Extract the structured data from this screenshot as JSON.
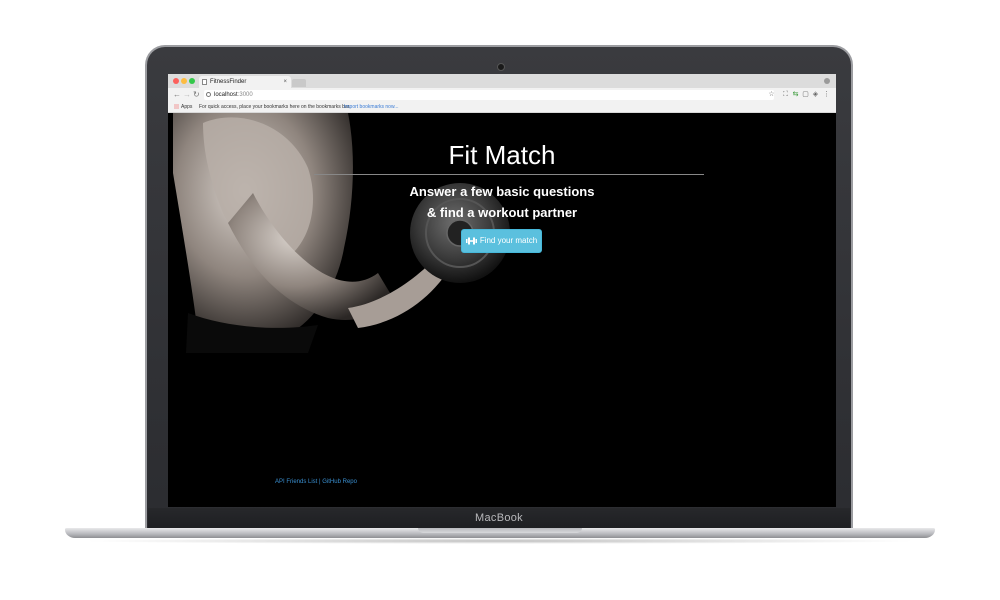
{
  "browser": {
    "tab_title": "FitnessFinder",
    "tab_close": "×",
    "url_host": "localhost",
    "url_port": ":3000",
    "bookmarks": {
      "apps_label": "Apps",
      "message": "For quick access, place your bookmarks here on the bookmarks bar.",
      "import_link": "Import bookmarks now..."
    }
  },
  "hero": {
    "title": "Fit Match",
    "subtitle_line1": "Answer a few basic questions",
    "subtitle_line2": "& find a workout partner",
    "cta_label": "Find your match"
  },
  "footer": {
    "link1": "API Friends List",
    "separator": "|",
    "link2": "GitHub Repo"
  },
  "device": {
    "brand": "MacBook"
  },
  "colors": {
    "cta": "#5bc0de",
    "link": "#3a8fd0",
    "page_background": "#000000"
  },
  "icons": {
    "cta": "dumbbell-icon",
    "tab": "document-icon",
    "address": "info-icon",
    "bookmark": "star-icon"
  }
}
